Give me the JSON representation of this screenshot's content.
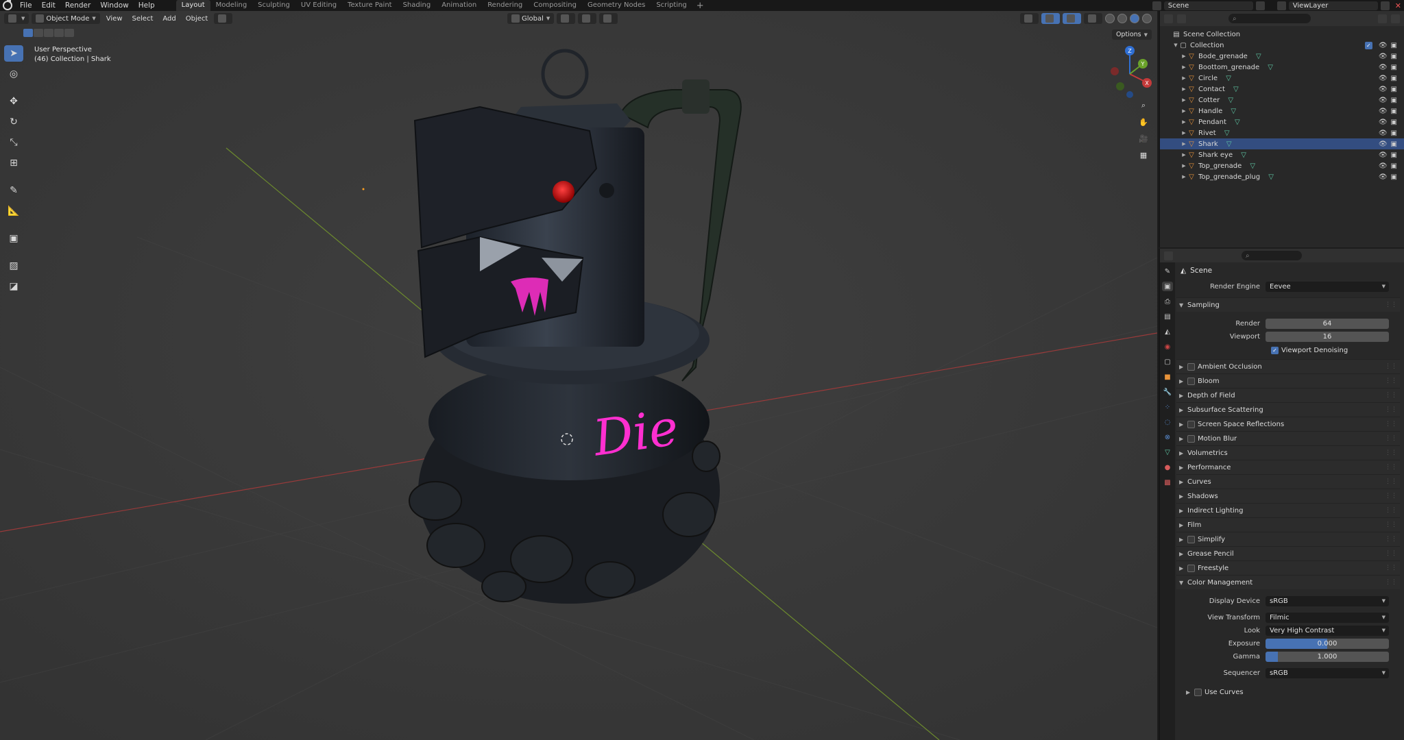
{
  "menu": [
    "File",
    "Edit",
    "Render",
    "Window",
    "Help"
  ],
  "workspaces": [
    {
      "label": "Layout",
      "active": true
    },
    {
      "label": "Modeling"
    },
    {
      "label": "Sculpting"
    },
    {
      "label": "UV Editing"
    },
    {
      "label": "Texture Paint"
    },
    {
      "label": "Shading"
    },
    {
      "label": "Animation"
    },
    {
      "label": "Rendering"
    },
    {
      "label": "Compositing"
    },
    {
      "label": "Geometry Nodes"
    },
    {
      "label": "Scripting"
    }
  ],
  "scene_name": "Scene",
  "view_layer": "ViewLayer",
  "viewport": {
    "mode": "Object Mode",
    "menus": [
      "View",
      "Select",
      "Add",
      "Object"
    ],
    "orientation": "Global",
    "options": "Options",
    "perspective": "User Perspective",
    "active": "(46) Collection | Shark"
  },
  "model_text": "Die",
  "gizmo": {
    "x": "X",
    "y": "Y",
    "z": "Z"
  },
  "outliner": {
    "root": "Scene Collection",
    "collection": "Collection",
    "items": [
      "Bode_grenade",
      "Boottom_grenade",
      "Circle",
      "Contact",
      "Cotter",
      "Handle",
      "Pendant",
      "Rivet",
      "Shark",
      "Shark eye",
      "Top_grenade",
      "Top_grenade_plug"
    ]
  },
  "properties": {
    "context": "Scene",
    "render_engine_label": "Render Engine",
    "render_engine": "Eevee",
    "sampling": {
      "title": "Sampling",
      "render_label": "Render",
      "render": "64",
      "viewport_label": "Viewport",
      "viewport": "16",
      "denoise": "Viewport Denoising"
    },
    "panels": [
      {
        "label": "Ambient Occlusion",
        "checkbox": true
      },
      {
        "label": "Bloom",
        "checkbox": true
      },
      {
        "label": "Depth of Field",
        "checkbox": false
      },
      {
        "label": "Subsurface Scattering",
        "checkbox": false
      },
      {
        "label": "Screen Space Reflections",
        "checkbox": true
      },
      {
        "label": "Motion Blur",
        "checkbox": true
      },
      {
        "label": "Volumetrics",
        "checkbox": false
      },
      {
        "label": "Performance",
        "checkbox": false
      },
      {
        "label": "Curves",
        "checkbox": false
      },
      {
        "label": "Shadows",
        "checkbox": false
      },
      {
        "label": "Indirect Lighting",
        "checkbox": false
      },
      {
        "label": "Film",
        "checkbox": false
      },
      {
        "label": "Simplify",
        "checkbox": true
      },
      {
        "label": "Grease Pencil",
        "checkbox": false
      },
      {
        "label": "Freestyle",
        "checkbox": true
      }
    ],
    "color_management": {
      "title": "Color Management",
      "display_device_label": "Display Device",
      "display_device": "sRGB",
      "view_transform_label": "View Transform",
      "view_transform": "Filmic",
      "look_label": "Look",
      "look": "Very High Contrast",
      "exposure_label": "Exposure",
      "exposure": "0.000",
      "gamma_label": "Gamma",
      "gamma": "1.000",
      "gamma_fill": 0.1,
      "sequencer_label": "Sequencer",
      "sequencer": "sRGB",
      "use_curves": "Use Curves"
    }
  },
  "colors": {
    "accent": "#4772b3",
    "viewport_bg": "#3b3b3b",
    "object_icon": "#e8933a",
    "mesh_icon": "#5fc9a6",
    "paint": "#ff2fd0"
  }
}
